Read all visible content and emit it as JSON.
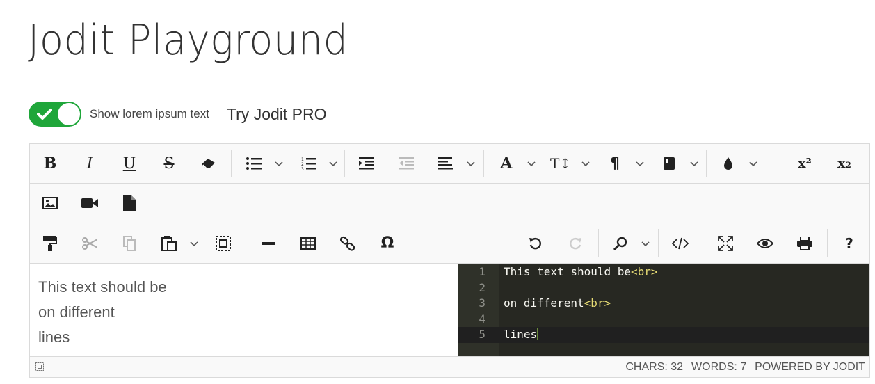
{
  "page": {
    "title": "Jodit Playground"
  },
  "controls": {
    "toggle_label": "Show lorem ipsum text",
    "toggle_on": true,
    "pro_link": "Try Jodit PRO",
    "accent_color": "#1fa63a"
  },
  "toolbar": {
    "row1": [
      "bold-icon",
      "italic-icon",
      "underline-icon",
      "strikethrough-icon",
      "eraser-icon",
      "bulleted-list-icon",
      "numbered-list-icon",
      "indent-icon",
      "outdent-icon",
      "align-left-icon",
      "font-icon",
      "font-size-icon",
      "paragraph-icon",
      "classes-icon",
      "brush-icon",
      "superscript-icon",
      "subscript-icon"
    ],
    "row2": [
      "image-icon",
      "video-icon",
      "file-icon"
    ],
    "row3": [
      "copy-format-icon",
      "cut-icon",
      "copy-icon",
      "paste-icon",
      "select-all-icon",
      "horizontal-rule-icon",
      "table-icon",
      "link-icon",
      "symbol-icon",
      "undo-icon",
      "redo-icon",
      "find-icon",
      "source-icon",
      "fullsize-icon",
      "preview-icon",
      "print-icon",
      "help-icon"
    ],
    "labels": {
      "bold": "B",
      "italic": "I",
      "underline": "U",
      "strike": "S",
      "font": "A",
      "fontsize": "T↕",
      "paragraph": "¶",
      "superscript": "x²",
      "subscript": "x₂",
      "symbol": "Ω",
      "help": "?"
    }
  },
  "editor": {
    "wysiwyg_lines": [
      "This text should be",
      "on different",
      "lines"
    ],
    "source_lines": [
      {
        "num": "1",
        "text": "This text should be",
        "tag": "<br>"
      },
      {
        "num": "2",
        "text": "",
        "tag": ""
      },
      {
        "num": "3",
        "text": "on different",
        "tag": "<br>"
      },
      {
        "num": "4",
        "text": "",
        "tag": ""
      },
      {
        "num": "5",
        "text": "lines",
        "tag": ""
      }
    ]
  },
  "status": {
    "chars": "CHARS: 32",
    "words": "WORDS: 7",
    "powered": "POWERED BY JODIT"
  }
}
